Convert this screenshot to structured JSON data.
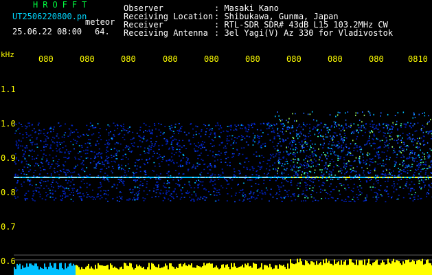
{
  "header": {
    "brand": "HROFFT",
    "filename": "UT2506220800.pn",
    "meteor_label": "meteor",
    "datetime": "25.06.22 08:00",
    "count": "64.",
    "info": [
      {
        "label": "Observer",
        "value": ": Masaki Kano"
      },
      {
        "label": "Receiving Location",
        "value": ": Shibukawa, Gunma, Japan"
      },
      {
        "label": "Receiver",
        "value": ": RTL-SDR SDR# 43dB L15 103.2MHz CW"
      },
      {
        "label": "Receiving Antenna",
        "value": ": 3el Yagi(V) Az 330 for Vladivostok"
      }
    ]
  },
  "axis": {
    "unit": "kHz",
    "time_ticks": [
      "080",
      "080",
      "080",
      "080",
      "080",
      "080",
      "080",
      "080",
      "080",
      "0810"
    ],
    "freq_ticks": [
      "1.1",
      "1.0",
      "0.9",
      "0.8",
      "0.7",
      "0.6"
    ]
  },
  "colors": {
    "background": "#000000",
    "brand": "#00ff40",
    "filename": "#00d8ff",
    "ticks": "#ffff00",
    "text": "#ffffff",
    "signal_low": "#0020c0",
    "signal_mid": "#00c0ff",
    "signal_high": "#ffff00"
  }
}
